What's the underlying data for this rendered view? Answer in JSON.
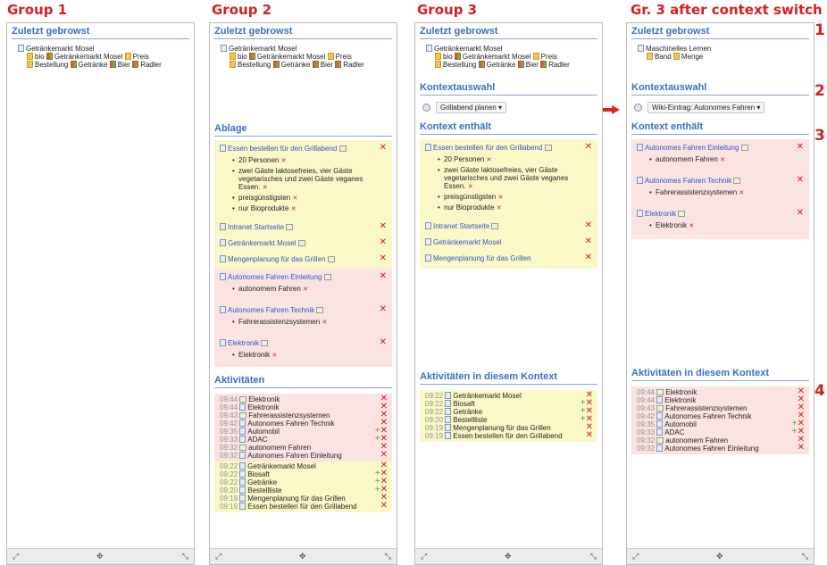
{
  "groups": [
    {
      "title": "Group 1"
    },
    {
      "title": "Group 2"
    },
    {
      "title": "Group 3"
    },
    {
      "title": "Gr. 3 after context switch"
    }
  ],
  "numbers": [
    "1",
    "2",
    "3",
    "4"
  ],
  "labels": {
    "recent": "Zuletzt gebrowst",
    "ablage": "Ablage",
    "aktivitaeten": "Aktivitäten",
    "kontextauswahl": "Kontextauswahl",
    "kontext_enthaelt": "Kontext enthält",
    "akt_kontext": "Aktivitäten in diesem Kontext"
  },
  "recent": {
    "g1": [
      "Getränkemarkt Mosel",
      "bio",
      "Getränkemarkt Mosel",
      "Preis",
      "Bestellung",
      "Getränke",
      "Bier",
      "Radler"
    ],
    "g4": [
      "Maschinelles Lernen",
      "Band",
      "Menge"
    ]
  },
  "context": {
    "g3": "Grillabend planen",
    "g4": "Wiki-Eintrag: Autonomes Fahren"
  },
  "essen": {
    "title": "Essen bestellen für den Grillabend",
    "items": [
      "20 Personen",
      "zwei Gäste laktosefreies, vier Gäste vegetarisches und zwei Gäste veganes Essen.",
      "preisgünstigsten",
      "nur Bioprodukte"
    ]
  },
  "yellow_links": [
    "Intranet Startseite",
    "Getränkemarkt Mosel",
    "Mengenplanung für das Grillen"
  ],
  "pink": [
    {
      "title": "Autonomes Fahren Einleitung",
      "item": "autonomem Fahren"
    },
    {
      "title": "Autonomes Fahren Technik",
      "item": "Fahrerassistenzsystemen"
    },
    {
      "title": "Elektronik",
      "item": "Elektronik"
    }
  ],
  "activities_pink": [
    {
      "time": "09:44",
      "label": "Elektronik",
      "plus": false
    },
    {
      "time": "09:44",
      "label": "Elektronik",
      "plus": false
    },
    {
      "time": "09:43",
      "label": "Fahrerassistenzsystemen",
      "plus": false
    },
    {
      "time": "09:42",
      "label": "Autonomes Fahren Technik",
      "plus": false
    },
    {
      "time": "09:35",
      "label": "Automobil",
      "plus": true
    },
    {
      "time": "09:33",
      "label": "ADAC",
      "plus": true
    },
    {
      "time": "09:32",
      "label": "autonomem Fahren",
      "plus": false
    },
    {
      "time": "09:32",
      "label": "Autonomes Fahren Einleitung",
      "plus": false
    }
  ],
  "activities_yellow": [
    {
      "time": "09:22",
      "label": "Getränkemarkt Mosel",
      "plus": false
    },
    {
      "time": "09:22",
      "label": "Biosaft",
      "plus": true
    },
    {
      "time": "09:22",
      "label": "Getränke",
      "plus": true
    },
    {
      "time": "09:20",
      "label": "Bestellliste",
      "plus": true
    },
    {
      "time": "09:19",
      "label": "Mengenplanung für das Grillen",
      "plus": false
    },
    {
      "time": "09:19",
      "label": "Essen bestellen für den Grillabend",
      "plus": false
    }
  ],
  "symbols": {
    "close": "✕",
    "plus": "+",
    "expand": "⤢",
    "move": "✥",
    "resize": "⤡",
    "caret": "▾"
  }
}
